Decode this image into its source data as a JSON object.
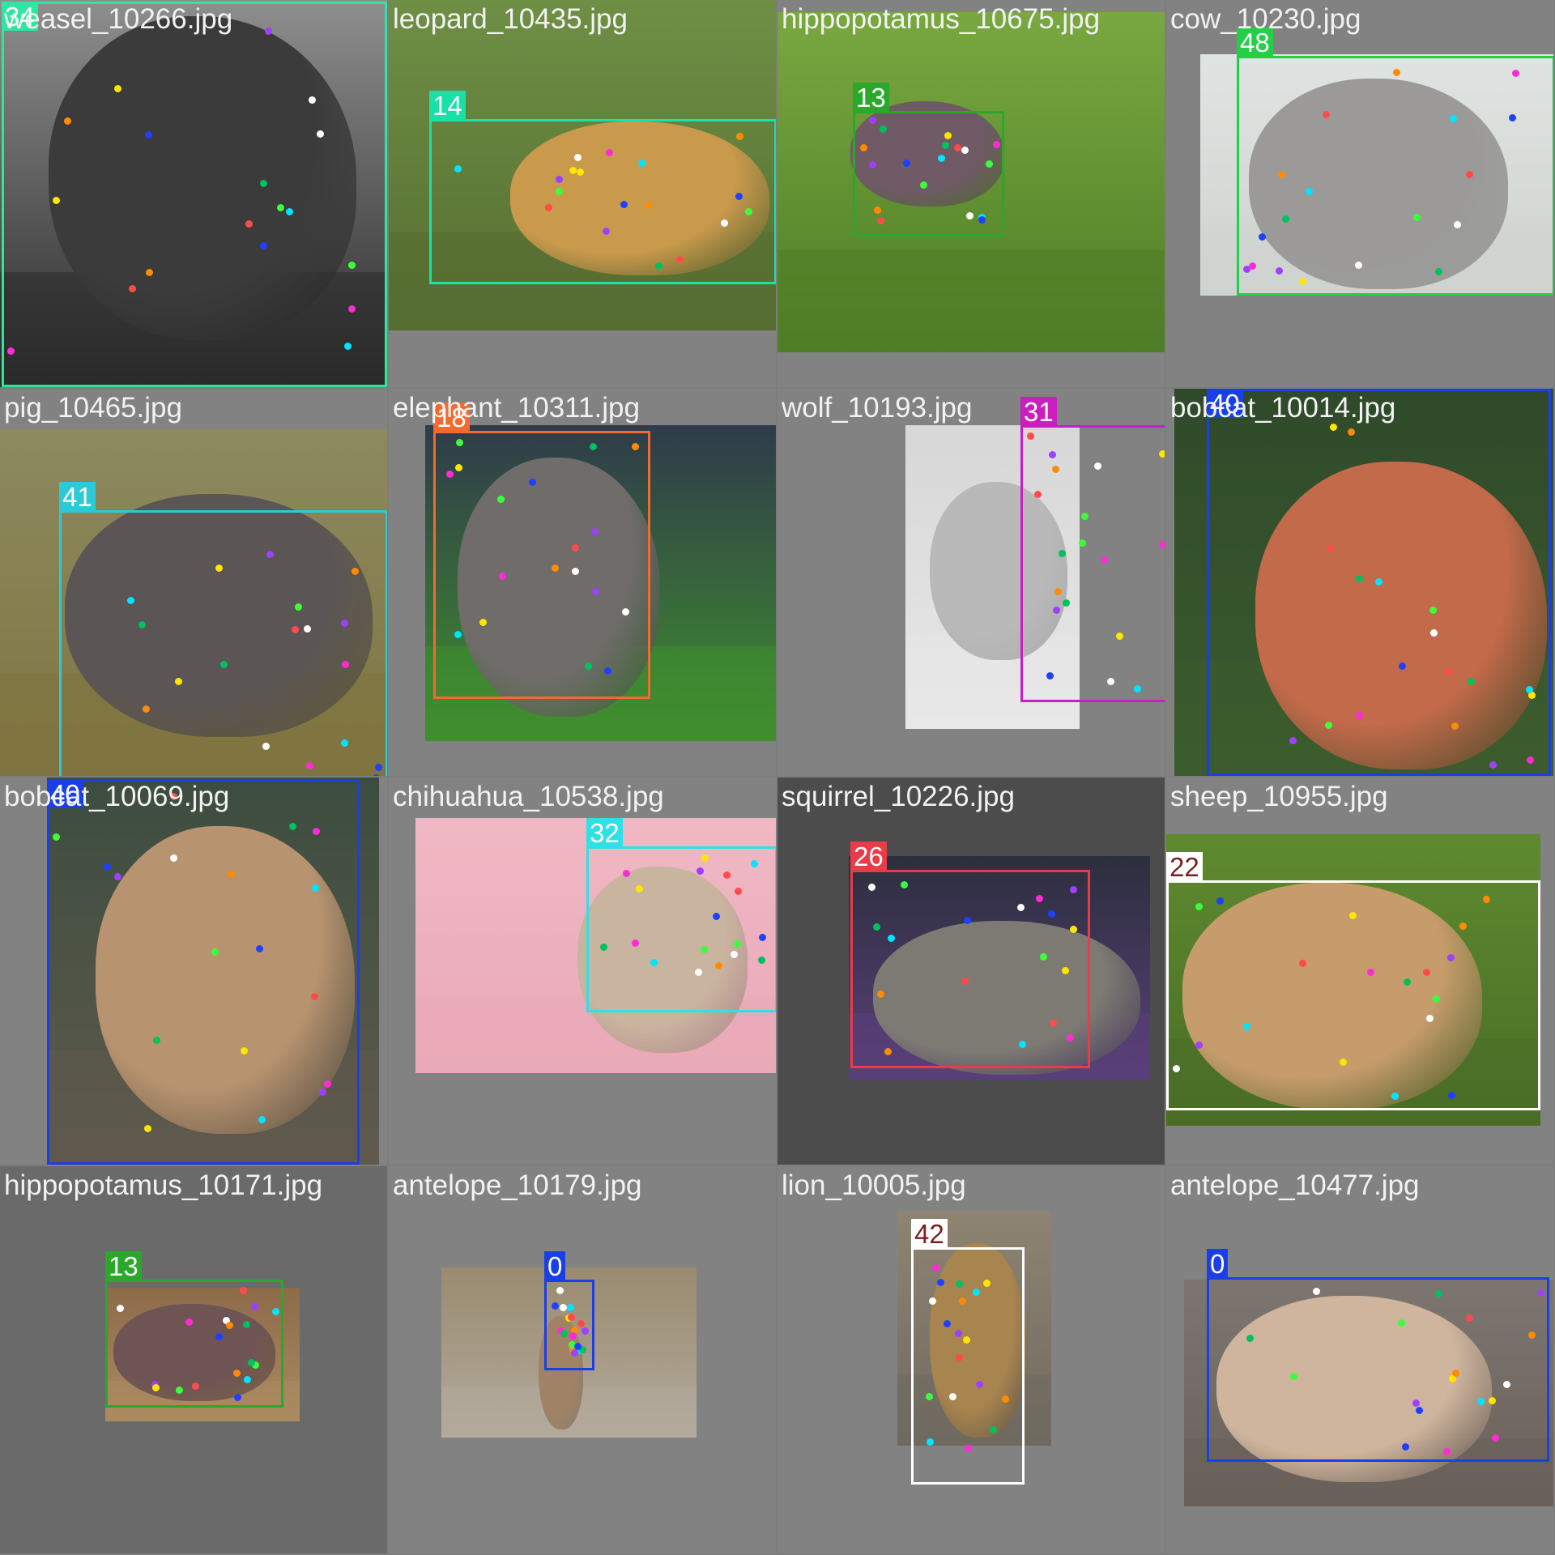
{
  "mosaic": {
    "tiles": [
      {
        "filename": "weasel_10266.jpg",
        "class_id": "34",
        "box_color": "#2ee6a0"
      },
      {
        "filename": "leopard_10435.jpg",
        "class_id": "14",
        "box_color": "#19e0a6"
      },
      {
        "filename": "hippopotamus_10675.jpg",
        "class_id": "13",
        "box_color": "#2ba82a"
      },
      {
        "filename": "cow_10230.jpg",
        "class_id": "48",
        "box_color": "#22cf45"
      },
      {
        "filename": "pig_10465.jpg",
        "class_id": "41",
        "box_color": "#2cc9d6"
      },
      {
        "filename": "elephant_10311.jpg",
        "class_id": "18",
        "box_color": "#f36a2e"
      },
      {
        "filename": "wolf_10193.jpg",
        "class_id": "31",
        "box_color": "#c91ec0"
      },
      {
        "filename": "bobcat_10014.jpg",
        "class_id": "40",
        "box_color": "#1b3fe6"
      },
      {
        "filename": "bobcat_10069.jpg",
        "class_id": "40",
        "box_color": "#1b3fe6"
      },
      {
        "filename": "chihuahua_10538.jpg",
        "class_id": "32",
        "box_color": "#2fe0e6"
      },
      {
        "filename": "squirrel_10226.jpg",
        "class_id": "26",
        "box_color": "#ea3b48"
      },
      {
        "filename": "sheep_10955.jpg",
        "class_id": "22",
        "box_color": "#ffffff",
        "label_text_color": "#7a1f1f"
      },
      {
        "filename": "hippopotamus_10171.jpg",
        "class_id": "13",
        "box_color": "#2ba82a"
      },
      {
        "filename": "antelope_10179.jpg",
        "class_id": "0",
        "box_color": "#1b3fe6"
      },
      {
        "filename": "lion_10005.jpg",
        "class_id": "42",
        "box_color": "#ffffff",
        "label_text_color": "#7a1f1f"
      },
      {
        "filename": "antelope_10477.jpg",
        "class_id": "0",
        "box_color": "#1b3fe6"
      }
    ]
  }
}
